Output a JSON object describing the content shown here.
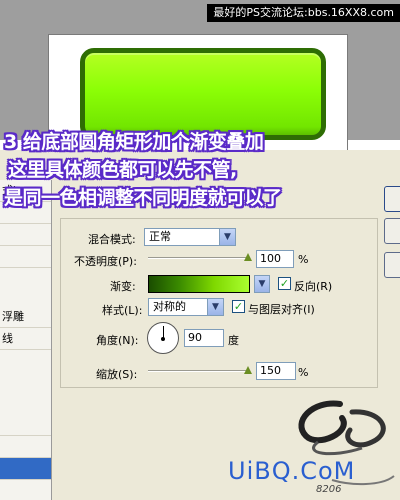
{
  "watermark": {
    "text": "最好的PS交流论坛:bbs.16XX8.com"
  },
  "annotation": {
    "line1": "3  给底部圆角矩形加个渐变叠加",
    "line2": "这里具体颜色都可以先不管,",
    "line3": "是同一色相调整不同明度就可以了"
  },
  "left_panel": {
    "items": [
      {
        "label": "式)"
      },
      {
        "label": ""
      },
      {
        "label": ""
      },
      {
        "label": ""
      },
      {
        "label": "浮雕"
      },
      {
        "label": "线"
      },
      {
        "label": ""
      },
      {
        "label": ""
      },
      {
        "label": ""
      },
      {
        "label": ""
      },
      {
        "label": ""
      },
      {
        "label": ""
      },
      {
        "label": ""
      }
    ]
  },
  "gradient_overlay": {
    "blend_mode": {
      "label": "混合模式:",
      "value": "正常"
    },
    "opacity": {
      "label": "不透明度(P):",
      "value": "100",
      "unit": "%",
      "level": 1.0
    },
    "gradient": {
      "label": "渐变:",
      "reverse_label": "反向(R)",
      "reverse_checked": true,
      "colors": [
        "#1a4d00",
        "#aaff30"
      ]
    },
    "style": {
      "label": "样式(L):",
      "value": "对称的",
      "align_label": "与图层对齐(I)",
      "align_checked": true
    },
    "angle": {
      "label": "角度(N):",
      "value": "90",
      "unit": "度"
    },
    "scale": {
      "label": "缩放(S):",
      "value": "150",
      "unit": "%",
      "level": 1.0
    }
  },
  "logo": {
    "text": "UiBQ.CoM",
    "sub": "8206"
  },
  "colors": {
    "rect_green": "#8cff06",
    "rect_border": "#2e6d04",
    "annotation_outline": "#5a2ac8",
    "selection_blue": "#316ac5"
  }
}
